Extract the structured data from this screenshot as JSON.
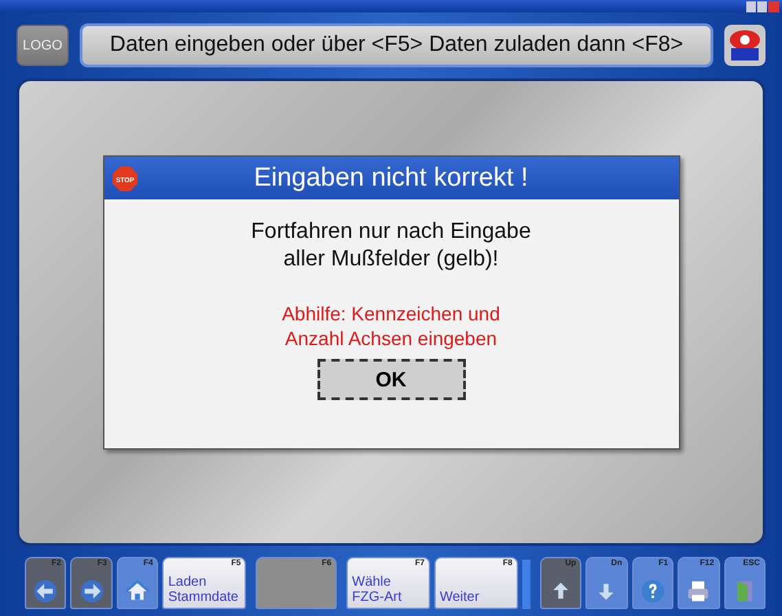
{
  "header": {
    "logo_button": "LOGO",
    "message": "Daten eingeben oder über <F5> Daten zuladen dann <F8>"
  },
  "dialog": {
    "title": "Eingaben nicht korrekt !",
    "stop_icon_label": "STOP",
    "message_lines": [
      "Fortfahren nur nach Eingabe",
      "aller Mußfelder (gelb)!"
    ],
    "hint_lines": [
      "Abhilfe: Kennzeichen und",
      "Anzahl Achsen eingeben"
    ],
    "button": "OK"
  },
  "function_keys": [
    {
      "key": "F2",
      "kind": "icon",
      "disabled": true
    },
    {
      "key": "F3",
      "kind": "icon",
      "disabled": true
    },
    {
      "key": "F4",
      "kind": "icon",
      "disabled": false
    },
    {
      "key": "F5",
      "kind": "text",
      "lines": [
        "Laden",
        "Stammdate"
      ],
      "disabled": false
    },
    {
      "key": "F6",
      "kind": "blank",
      "disabled": true
    },
    {
      "key": "F7",
      "kind": "text",
      "lines": [
        "Wähle",
        "FZG-Art"
      ],
      "disabled": false
    },
    {
      "key": "F8",
      "kind": "text",
      "lines": [
        "Weiter"
      ],
      "disabled": false
    },
    {
      "kind": "separator"
    },
    {
      "key": "Up",
      "kind": "icon",
      "disabled": true
    },
    {
      "key": "Dn",
      "kind": "icon",
      "disabled": false
    },
    {
      "key": "F1",
      "kind": "icon",
      "disabled": false
    },
    {
      "key": "F12",
      "kind": "icon",
      "disabled": false
    },
    {
      "key": "ESC",
      "kind": "icon",
      "disabled": false
    }
  ]
}
